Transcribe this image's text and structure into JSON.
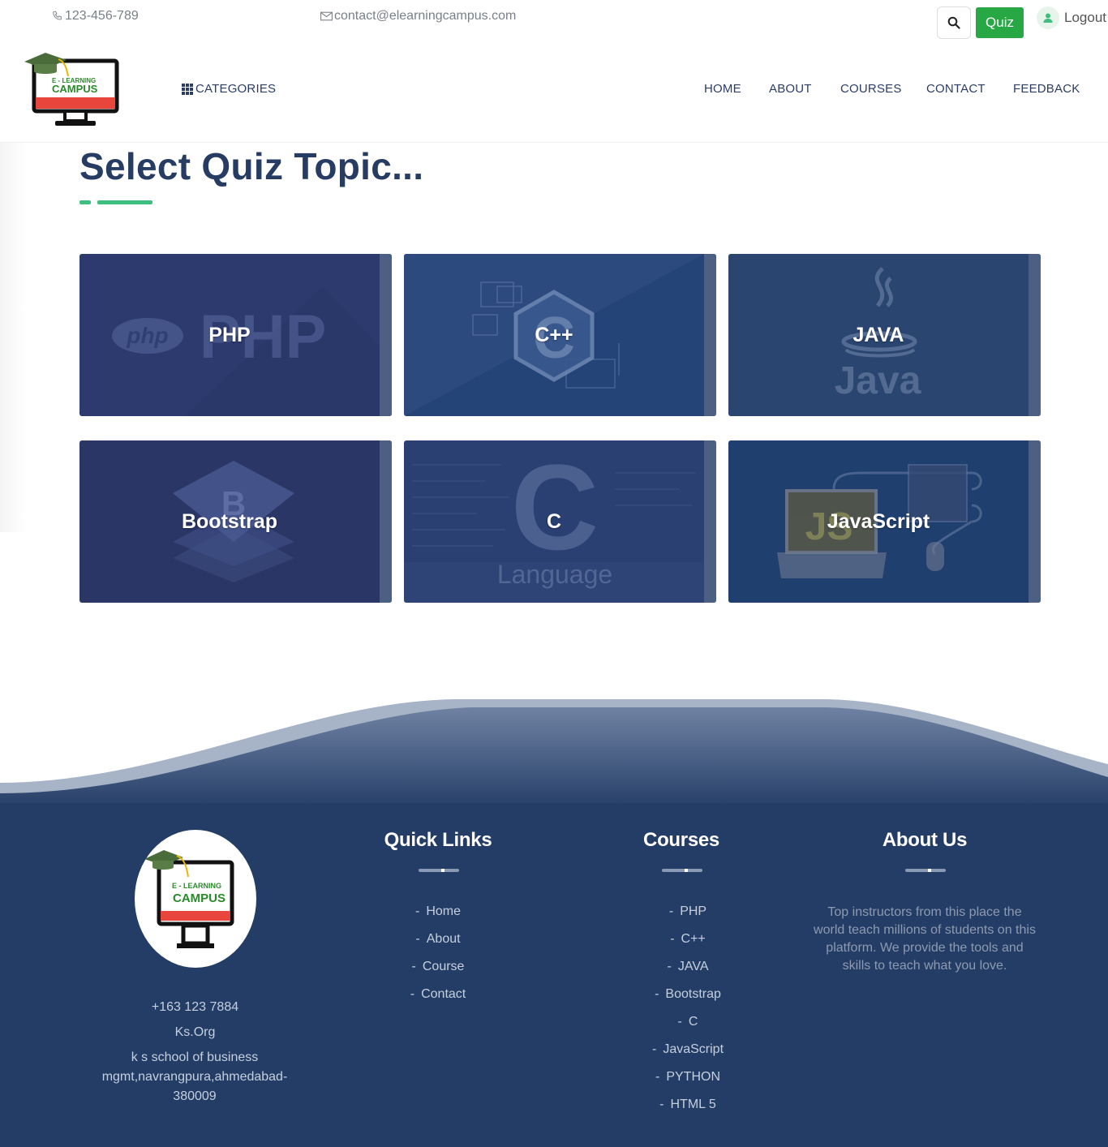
{
  "topbar": {
    "phone": "123-456-789",
    "email": "contact@elearningcampus.com",
    "quiz_label": "Quiz",
    "logout_label": "Logout"
  },
  "logo": {
    "line1": "E - LEARNING",
    "line2": "CAMPUS"
  },
  "nav": {
    "categories": "CATEGORIES",
    "items": [
      "HOME",
      "ABOUT",
      "COURSES",
      "CONTACT",
      "FEEDBACK"
    ]
  },
  "main": {
    "title": "Select Quiz Topic...",
    "cards": [
      {
        "label": "PHP",
        "art": "PHP",
        "art_sub": "php",
        "color": "#2c3a6e"
      },
      {
        "label": "C++",
        "art": "C",
        "color": "#244478"
      },
      {
        "label": "JAVA",
        "art": "Java",
        "color": "#2a4670"
      },
      {
        "label": "Bootstrap",
        "art": "B",
        "color": "#2a3666"
      },
      {
        "label": "C",
        "art": "C",
        "art_sub": "Language",
        "color": "#2a3f72"
      },
      {
        "label": "JavaScript",
        "art": "JS",
        "color": "#1f3f6e"
      }
    ]
  },
  "footer": {
    "contact": {
      "phone": "+163 123 7884",
      "org": "Ks.Org",
      "address": "k s school of business mgmt,navrangpura,ahmedabad-380009"
    },
    "quick_links": {
      "heading": "Quick Links",
      "items": [
        "Home",
        "About",
        "Course",
        "Contact"
      ]
    },
    "courses": {
      "heading": "Courses",
      "items": [
        "PHP",
        "C++",
        "JAVA",
        "Bootstrap",
        "C",
        "JavaScript",
        "PYTHON",
        "HTML 5"
      ]
    },
    "about": {
      "heading": "About Us",
      "text": "Top instructors from this place the world teach millions of students on this platform. We provide the tools and skills to teach what you love."
    },
    "bg_color": "#243d66"
  },
  "colors": {
    "accent_green": "#28a745",
    "underline_green": "#3fbf7f",
    "navy": "#263c63"
  }
}
